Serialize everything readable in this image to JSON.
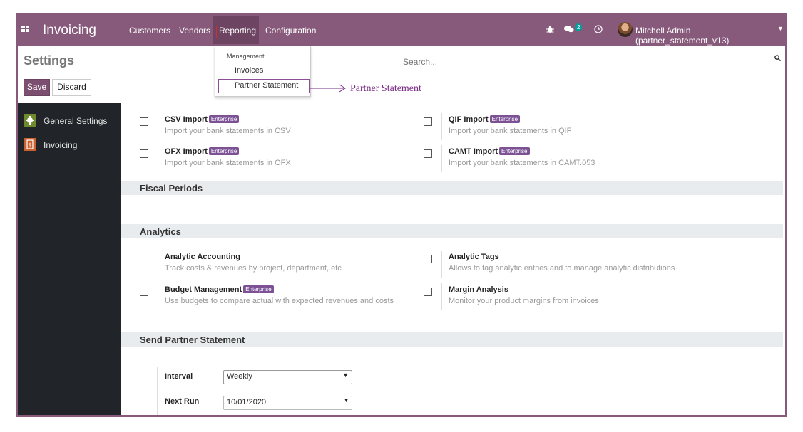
{
  "navbar": {
    "app_title": "Invoicing",
    "menu": [
      "Customers",
      "Vendors",
      "Reporting",
      "Configuration"
    ],
    "chat_badge": "2",
    "user": "Mitchell Admin (partner_statement_v13)"
  },
  "control_panel": {
    "title": "Settings",
    "save_label": "Save",
    "discard_label": "Discard",
    "search_placeholder": "Search..."
  },
  "sidebar": {
    "items": [
      {
        "label": "General Settings",
        "icon": "gear-icon",
        "color": "#6f8a2c"
      },
      {
        "label": "Invoicing",
        "icon": "invoice-icon",
        "color": "#c9622f"
      }
    ]
  },
  "dropdown": {
    "header": "Management",
    "items": [
      "Invoices",
      "Partner Statement"
    ]
  },
  "annotation": "Partner Statement",
  "enterprise_badge": "Enterprise",
  "settings": {
    "csv": {
      "title": "CSV Import",
      "desc": "Import your bank statements in CSV"
    },
    "qif": {
      "title": "QIF Import",
      "desc": "Import your bank statements in QIF"
    },
    "ofx": {
      "title": "OFX Import",
      "desc": "Import your bank statements in OFX"
    },
    "camt": {
      "title": "CAMT Import",
      "desc": "Import your bank statements in CAMT.053"
    },
    "analytic_accounting": {
      "title": "Analytic Accounting",
      "desc": "Track costs & revenues by project, department, etc"
    },
    "analytic_tags": {
      "title": "Analytic Tags",
      "desc": "Allows to tag analytic entries and to manage analytic distributions"
    },
    "budget": {
      "title": "Budget Management",
      "desc": "Use budgets to compare actual with expected revenues and costs"
    },
    "margin": {
      "title": "Margin Analysis",
      "desc": "Monitor your product margins from invoices"
    }
  },
  "sections": {
    "fiscal": "Fiscal Periods",
    "analytics": "Analytics",
    "partner_statement": "Send Partner Statement"
  },
  "partner_statement_fields": {
    "interval_label": "Interval",
    "interval_value": "Weekly",
    "next_run_label": "Next Run",
    "next_run_value": "10/01/2020"
  },
  "colors": {
    "brand": "#875a7b",
    "sidebar": "#212529",
    "enterprise": "#7c5295"
  }
}
